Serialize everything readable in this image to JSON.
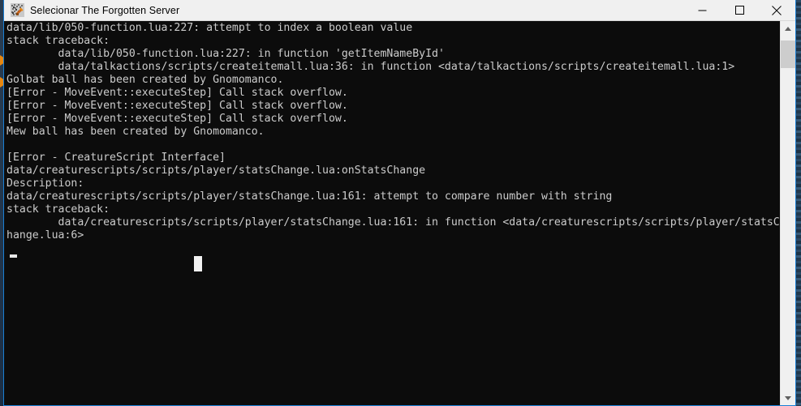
{
  "window": {
    "title": "Selecionar The Forgotten Server",
    "icon": "forgotten-server-app-icon",
    "colors": {
      "titlebar_bg": "#f0f0f0",
      "titlebar_text": "#000000",
      "console_bg": "#0c0c0c",
      "console_text": "#cccccc",
      "window_border": "#1a7fd4",
      "scrollbar_track": "#f0f0f0",
      "scrollbar_thumb": "#cdcdcd",
      "desktop_accent": "#e8870f"
    },
    "controls": {
      "minimize": "minimize-icon",
      "maximize": "maximize-icon",
      "close": "close-icon"
    }
  },
  "console": {
    "lines": [
      "data/lib/050-function.lua:227: attempt to index a boolean value",
      "stack traceback:",
      "        data/lib/050-function.lua:227: in function 'getItemNameById'",
      "        data/talkactions/scripts/createitemall.lua:36: in function <data/talkactions/scripts/createitemall.lua:1>",
      "Golbat ball has been created by Gnomomanco.",
      "[Error - MoveEvent::executeStep] Call stack overflow.",
      "[Error - MoveEvent::executeStep] Call stack overflow.",
      "[Error - MoveEvent::executeStep] Call stack overflow.",
      "Mew ball has been created by Gnomomanco.",
      "",
      "[Error - CreatureScript Interface]",
      "data/creaturescripts/scripts/player/statsChange.lua:onStatsChange",
      "Description:",
      "data/creaturescripts/scripts/player/statsChange.lua:161: attempt to compare number with string",
      "stack traceback:",
      "        data/creaturescripts/scripts/player/statsChange.lua:161: in function <data/creaturescripts/scripts/player/statsC",
      "hange.lua:6>"
    ],
    "cursor": {
      "prompt_caret": "_",
      "block_cursor": "█"
    }
  },
  "scrollbar": {
    "up_arrow": "scroll-up-icon",
    "down_arrow": "scroll-down-icon",
    "thumb": "scrollbar-thumb"
  }
}
